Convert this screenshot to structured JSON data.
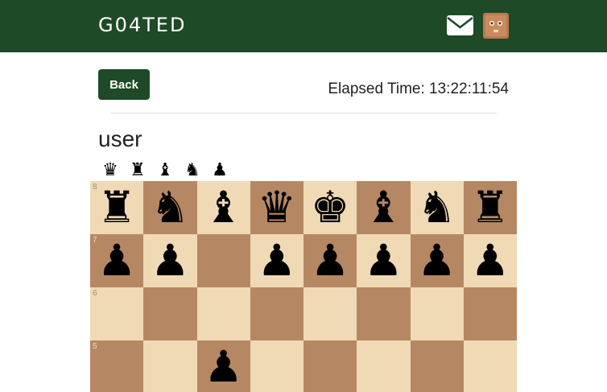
{
  "header": {
    "brand": "G04TED",
    "icons": [
      "mail-icon",
      "avatar"
    ]
  },
  "controls": {
    "back_label": "Back",
    "elapsed": "Elapsed Time: 13:22:11:54"
  },
  "opponent": {
    "name": "user",
    "captured": [
      "♛",
      "♜",
      "♝",
      "♞",
      "♟"
    ]
  },
  "colors": {
    "navbar": "#1e4a27",
    "light_square": "#f0d9b5",
    "dark_square": "#b58863"
  },
  "board": {
    "ranks": [
      {
        "label": "8",
        "squares": [
          "♜",
          "♞",
          "♝",
          "♛",
          "♚",
          "♝",
          "♞",
          "♜"
        ]
      },
      {
        "label": "7",
        "squares": [
          "♟",
          "♟",
          "",
          "♟",
          "♟",
          "♟",
          "♟",
          "♟"
        ]
      },
      {
        "label": "6",
        "squares": [
          "",
          "",
          "",
          "",
          "",
          "",
          "",
          ""
        ]
      },
      {
        "label": "5",
        "squares": [
          "",
          "",
          "♟",
          "",
          "",
          "",
          "",
          ""
        ]
      }
    ]
  }
}
